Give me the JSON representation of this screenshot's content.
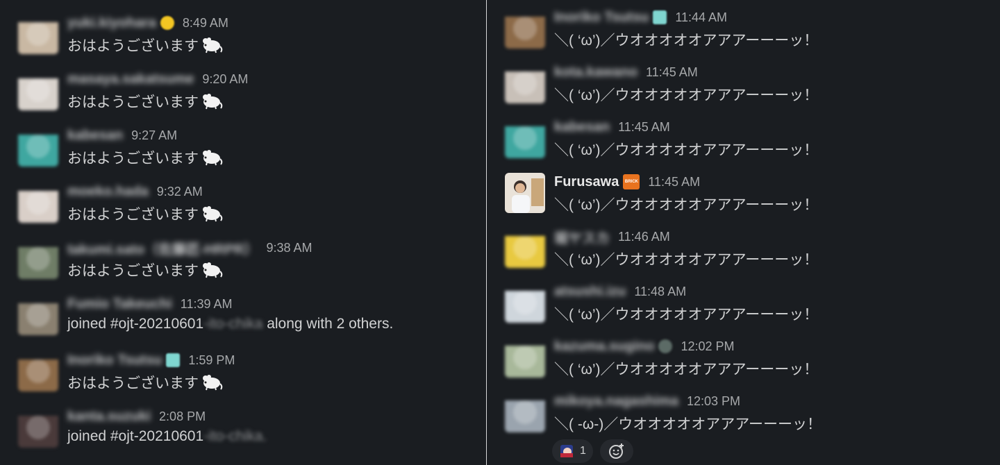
{
  "left_panel": {
    "messages": [
      {
        "user": "yuki.kiyohara",
        "time": "8:49 AM",
        "text": "おはようございます",
        "has_rat": true,
        "avatar_color": "#c9b8a3",
        "badge": "emoji-face"
      },
      {
        "user": "masaya.sakatsume",
        "time": "9:20 AM",
        "text": "おはようございます",
        "has_rat": true,
        "avatar_color": "#d8d2cc"
      },
      {
        "user": "kabesan",
        "time": "9:27 AM",
        "text": "おはようございます",
        "has_rat": true,
        "avatar_color": "#3fa7a0"
      },
      {
        "user": "moeko.hada",
        "time": "9:32 AM",
        "text": "おはようございます",
        "has_rat": true,
        "avatar_color": "#d9cfc8"
      },
      {
        "user": "takumi.sato（佐藤匠-HRPR）",
        "time": "9:38 AM",
        "text": "おはようございます",
        "has_rat": true,
        "avatar_color": "#6f7d66"
      },
      {
        "user": "Fumio Takeuchi",
        "time": "11:39 AM",
        "text": "joined #ojt-20210601",
        "blurred_suffix": "-ito-chika",
        "suffix": " along with 2 others.",
        "has_rat": false,
        "avatar_color": "#8a8070"
      },
      {
        "user": "Inoriko Tsutsu",
        "time": "1:59 PM",
        "text": "おはようございます",
        "has_rat": true,
        "avatar_color": "#8c6a48",
        "badge": "teal-box"
      },
      {
        "user": "kanta.suzuki",
        "time": "2:08 PM",
        "text": "joined #ojt-20210601",
        "blurred_suffix": "-ito-chika.",
        "suffix": "",
        "has_rat": false,
        "avatar_color": "#4a3a3a"
      }
    ]
  },
  "right_panel": {
    "messages": [
      {
        "user": "Inoriko Tsutsu",
        "time": "11:44 AM",
        "text": "＼( ‘ω’)／ウオオオオオアアアーーーッ！",
        "avatar_color": "#8c6a48",
        "badge": "teal-box"
      },
      {
        "user": "kota.kawano",
        "time": "11:45 AM",
        "text": "＼( ‘ω’)／ウオオオオオアアアーーーッ！",
        "avatar_color": "#c8c0b8"
      },
      {
        "user": "kabesan",
        "time": "11:45 AM",
        "text": "＼( ‘ω’)／ウオオオオオアアアーーーッ！",
        "avatar_color": "#3fa7a0"
      },
      {
        "user": "Furusawa",
        "time": "11:45 AM",
        "text": "＼( ‘ω’)／ウオオオオオアアアーーーッ！",
        "avatar_color": "#cfc6bb",
        "sharp": true,
        "badge": "brick"
      },
      {
        "user": "堀ヤスカ",
        "time": "11:46 AM",
        "text": "＼( ‘ω’)／ウオオオオオアアアーーーッ！",
        "avatar_color": "#e8c940"
      },
      {
        "user": "atsushi.izu",
        "time": "11:48 AM",
        "text": "＼( ‘ω’)／ウオオオオオアアアーーーッ！",
        "avatar_color": "#cfd6dc"
      },
      {
        "user": "kazuma.sugino",
        "time": "12:02 PM",
        "text": "＼( ‘ω’)／ウオオオオオアアアーーーッ！",
        "avatar_color": "#a8b89a",
        "badge": "globe"
      },
      {
        "user": "mikoya.nagashima",
        "time": "12:03 PM",
        "text": "＼( -ω-)／ウオオオオオアアアーーーッ！",
        "avatar_color": "#9aa4ae"
      }
    ],
    "reaction": {
      "count": "1"
    },
    "brick_label": "BRICK"
  }
}
